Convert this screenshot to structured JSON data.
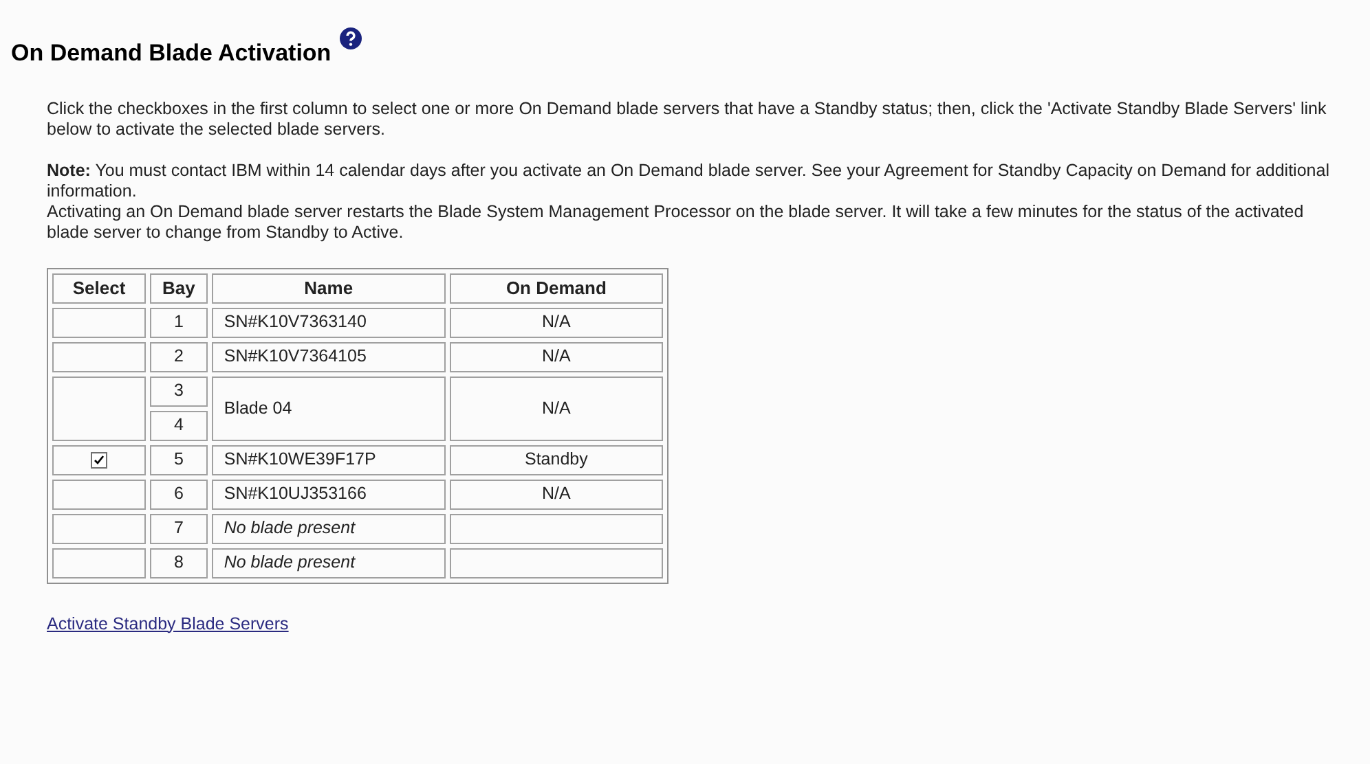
{
  "title": "On Demand Blade Activation",
  "intro": "Click the checkboxes in the first column to select one or more On Demand blade servers that have a Standby status; then, click the 'Activate Standby Blade Servers' link below to activate the selected blade servers.",
  "note": {
    "label": "Note:",
    "lines": [
      "You must contact IBM within 14 calendar days after you activate an On Demand blade server. See your Agreement for Standby Capacity on Demand for additional information.",
      "Activating an On Demand blade server restarts the Blade System Management Processor on the blade server. It will take a few minutes for the status of the activated blade server to change from Standby to Active."
    ]
  },
  "table": {
    "columns": [
      "Select",
      "Bay",
      "Name",
      "On Demand"
    ],
    "rows": [
      {
        "kind": "blade",
        "bays": [
          "1"
        ],
        "name": "SN#K10V7363140",
        "on_demand": "N/A"
      },
      {
        "kind": "blade",
        "bays": [
          "2"
        ],
        "name": "SN#K10V7364105",
        "on_demand": "N/A"
      },
      {
        "kind": "blade",
        "bays": [
          "3",
          "4"
        ],
        "name": "Blade 04",
        "on_demand": "N/A"
      },
      {
        "kind": "blade",
        "bays": [
          "5"
        ],
        "name": "SN#K10WE39F17P",
        "on_demand": "Standby",
        "checkbox": {
          "checked": true
        }
      },
      {
        "kind": "blade",
        "bays": [
          "6"
        ],
        "name": "SN#K10UJ353166",
        "on_demand": "N/A"
      },
      {
        "kind": "empty",
        "bays": [
          "7"
        ],
        "name": "No blade present"
      },
      {
        "kind": "empty",
        "bays": [
          "8"
        ],
        "name": "No blade present"
      }
    ]
  },
  "link": "Activate Standby Blade Servers"
}
